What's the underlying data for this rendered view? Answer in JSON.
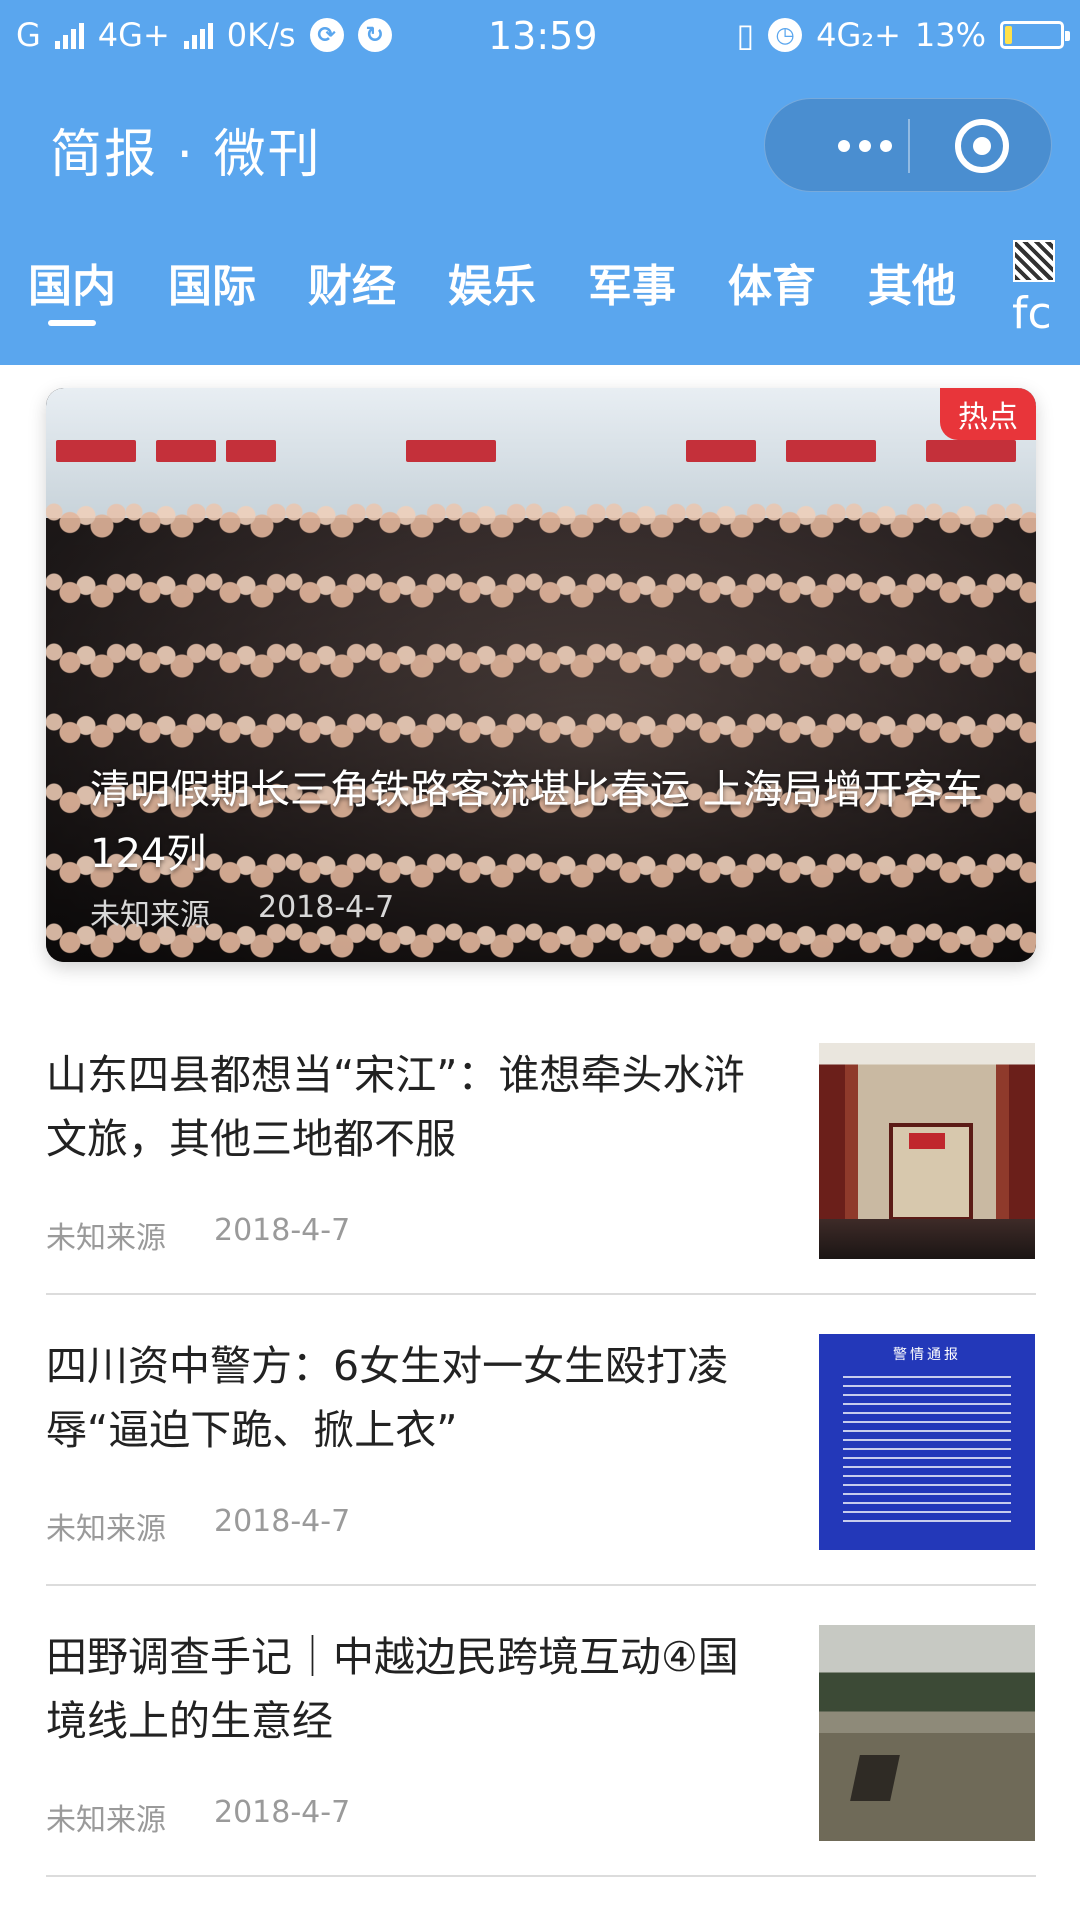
{
  "status_bar": {
    "carrier1": "G",
    "network": "4G+",
    "speed": "0K/s",
    "time": "13:59",
    "network2": "4G₂+",
    "battery": "13%",
    "battery_level": 0.13
  },
  "app": {
    "title": "简报 · 微刊"
  },
  "tabs": [
    {
      "label": "国内",
      "active": true
    },
    {
      "label": "国际",
      "active": false
    },
    {
      "label": "财经",
      "active": false
    },
    {
      "label": "娱乐",
      "active": false
    },
    {
      "label": "军事",
      "active": false
    },
    {
      "label": "体育",
      "active": false
    },
    {
      "label": "其他",
      "active": false
    }
  ],
  "corner_label": "fc",
  "featured": {
    "badge": "热点",
    "title": "清明假期长三角铁路客流堪比春运 上海局增开客车124列",
    "source": "未知来源",
    "date": "2018-4-7"
  },
  "notice_image_heading": "警情通报",
  "articles": [
    {
      "title": "山东四县都想当“宋江”：谁想牵头水浒文旅，其他三地都不服",
      "source": "未知来源",
      "date": "2018-4-7"
    },
    {
      "title": "四川资中警方：6女生对一女生殴打凌辱“逼迫下跪、掀上衣”",
      "source": "未知来源",
      "date": "2018-4-7"
    },
    {
      "title": "田野调查手记｜中越边民跨境互动④国境线上的生意经",
      "source": "未知来源",
      "date": "2018-4-7"
    }
  ]
}
